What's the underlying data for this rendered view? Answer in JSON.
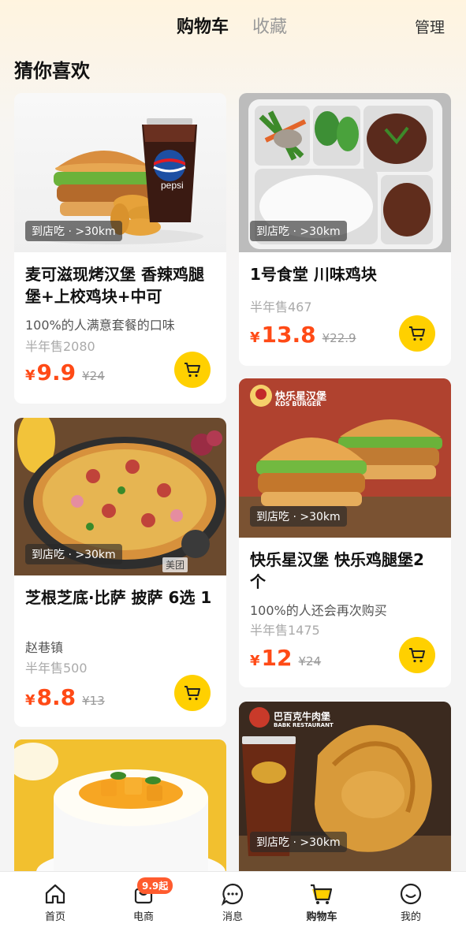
{
  "header": {
    "tab_active": "购物车",
    "tab_inactive": "收藏",
    "manage": "管理"
  },
  "section_title": "猜你喜欢",
  "products": [
    {
      "badge": "到店吃 · >30km",
      "title": "麦可滋现烤汉堡 香辣鸡腿堡+上校鸡块+中可",
      "subtitle": "100%的人满意套餐的口味",
      "sold": "半年售2080",
      "price": "9.9",
      "original": "¥24"
    },
    {
      "badge": "到店吃 · >30km",
      "title": "1号食堂 川味鸡块",
      "subtitle": "",
      "sold": "半年售467",
      "price": "13.8",
      "original": "¥22.9"
    },
    {
      "badge": "到店吃 · >30km",
      "watermark": "美团",
      "title": "芝根芝底·比萨 披萨 6选 1",
      "subtitle": "赵巷镇",
      "sold": "半年售500",
      "price": "8.8",
      "original": "¥13"
    },
    {
      "badge": "到店吃 · >30km",
      "title": "快乐星汉堡 快乐鸡腿堡2个",
      "subtitle": "100%的人还会再次购买",
      "sold": "半年售1475",
      "price": "12",
      "original": "¥24",
      "brand_text": "快乐星汉堡",
      "brand_sub": "KDS BURGER"
    },
    {
      "badge": "",
      "title": "",
      "subtitle": "",
      "sold": "",
      "price": "",
      "original": ""
    },
    {
      "badge": "到店吃 · >30km",
      "title": "",
      "subtitle": "",
      "sold": "",
      "price": "",
      "original": "",
      "brand_text": "巴百克牛肉堡",
      "brand_sub": "BABK RESTAURANT"
    }
  ],
  "currency": "¥",
  "bottom_nav": [
    {
      "label": "首页",
      "icon": "home-icon"
    },
    {
      "label": "电商",
      "icon": "bag-icon",
      "promo": "9.9起"
    },
    {
      "label": "消息",
      "icon": "message-icon"
    },
    {
      "label": "购物车",
      "icon": "cart-icon",
      "active": true
    },
    {
      "label": "我的",
      "icon": "smile-icon"
    }
  ],
  "colors": {
    "accent": "#ff4a16",
    "cart": "#ffd000",
    "promo": "#ff5b2e"
  }
}
